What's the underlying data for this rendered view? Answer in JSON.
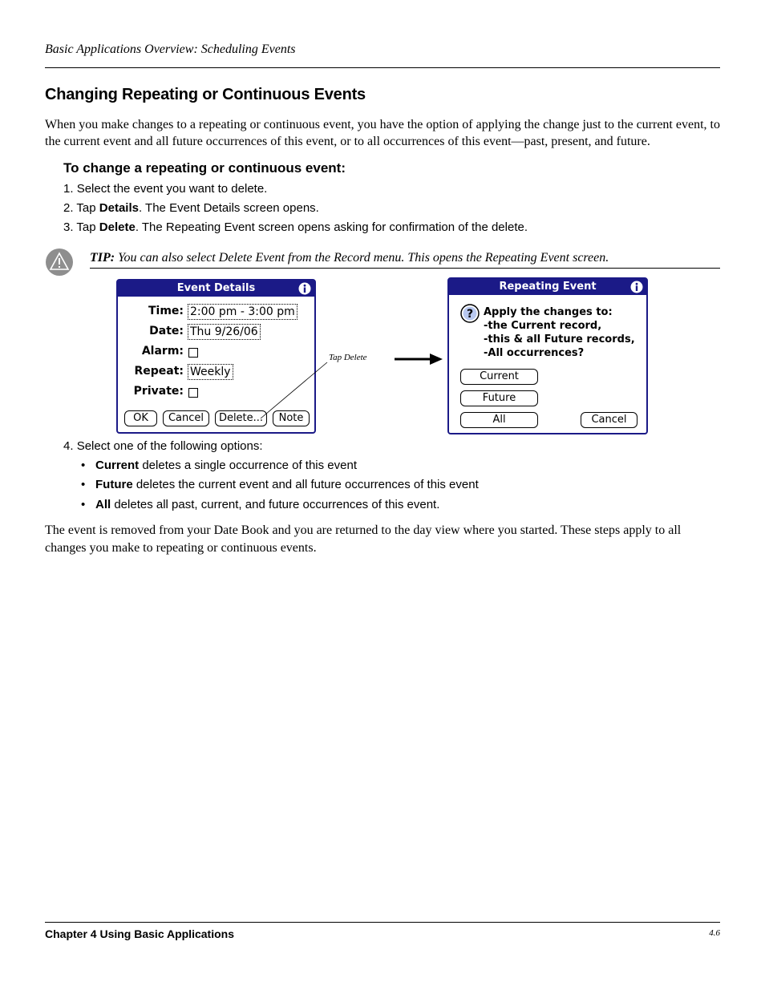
{
  "header": {
    "running_title": "Basic Applications Overview: Scheduling Events"
  },
  "section": {
    "title": "Changing Repeating or Continuous Events",
    "intro": "When you make changes to a repeating or continuous event, you have the option of applying the change just to the current event, to the current event and all future occurrences of this event, or to all occurrences of this event—past, present, and future."
  },
  "procedure": {
    "heading": "To change a repeating or continuous event:",
    "steps": [
      {
        "num": "1.",
        "pre": "Select the event you want to delete.",
        "bold": "",
        "post": ""
      },
      {
        "num": "2.",
        "pre": "Tap ",
        "bold": "Details",
        "post": ". The Event Details screen opens."
      },
      {
        "num": "3.",
        "pre": "Tap ",
        "bold": "Delete",
        "post": ". The Repeating Event screen opens asking for confirmation of the delete."
      },
      {
        "num": "4.",
        "pre": "Select one of the following options:",
        "bold": "",
        "post": ""
      }
    ],
    "options": [
      {
        "bold": "Current",
        "text": " deletes a single occurrence of this event"
      },
      {
        "bold": "Future",
        "text": " deletes the current event and all future occurrences of this event"
      },
      {
        "bold": "All",
        "text": " deletes all past, current, and future occurrences of this event."
      }
    ]
  },
  "tip": {
    "label": "TIP:",
    "text": " You can also select Delete Event from the Record menu. This opens the Repeating Event screen.",
    "icon": "warning-icon"
  },
  "event_details": {
    "title": "Event Details",
    "time_label": "Time:",
    "time_value": "2:00 pm - 3:00 pm",
    "date_label": "Date:",
    "date_value": "Thu 9/26/06",
    "alarm_label": "Alarm:",
    "repeat_label": "Repeat:",
    "repeat_value": "Weekly",
    "private_label": "Private:",
    "buttons": {
      "ok": "OK",
      "cancel": "Cancel",
      "delete": "Delete...",
      "note": "Note"
    }
  },
  "callout": "Tap Delete",
  "repeating_event": {
    "title": "Repeating Event",
    "lines": [
      "Apply the changes to:",
      "-the Current record,",
      "-this & all Future records,",
      "-All occurrences?"
    ],
    "buttons": {
      "current": "Current",
      "future": "Future",
      "all": "All",
      "cancel": "Cancel"
    }
  },
  "outro": "The event is removed from your Date Book and you are returned to the day view where you started. These steps apply to all changes you make to repeating or continuous events.",
  "footer": {
    "chapter": "Chapter 4 Using Basic Applications",
    "page": "4.6"
  },
  "colors": {
    "palm_blue": "#1b1a87",
    "icon_gray": "#8e8e8e"
  }
}
